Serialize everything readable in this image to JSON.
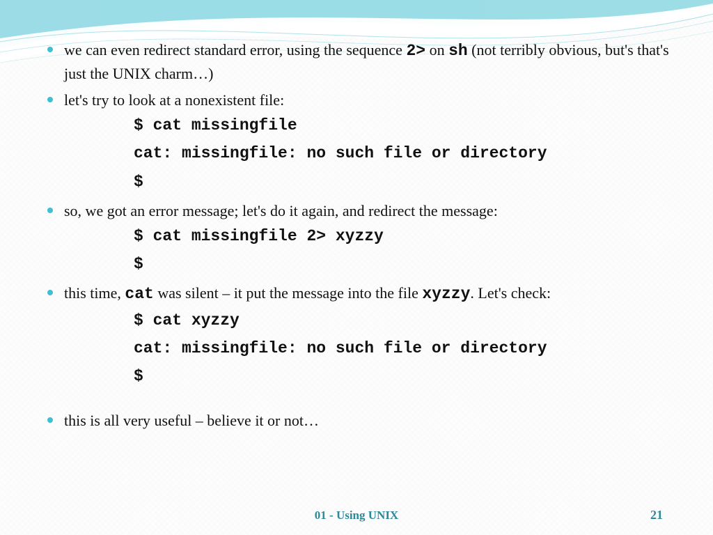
{
  "bullets": {
    "b1_pre": "we can even redirect standard error, using the sequence ",
    "b1_code1": "2>",
    "b1_mid": " on ",
    "b1_code2": "sh",
    "b1_post": " (not terribly obvious, but's that's just the UNIX charm…)",
    "b2": "let's try to look at a nonexistent file:",
    "b3": "so, we got an error message; let's do it again, and redirect the message:",
    "b4_pre": "this time, ",
    "b4_code1": "cat",
    "b4_mid": " was silent – it put the message into the file ",
    "b4_code2": "xyzzy",
    "b4_post": ". Let's check:",
    "b5": "this is all very useful – believe it or not…"
  },
  "code": {
    "block1_l1": "$ cat missingfile",
    "block1_l2": "cat: missingfile: no such file or directory",
    "block1_l3": "$",
    "block2_l1": "$ cat missingfile 2> xyzzy",
    "block2_l2": "$",
    "block3_l1": "$ cat xyzzy",
    "block3_l2": "cat: missingfile: no such file or directory",
    "block3_l3": "$"
  },
  "footer": {
    "title": "01 - Using UNIX",
    "page": "21"
  }
}
